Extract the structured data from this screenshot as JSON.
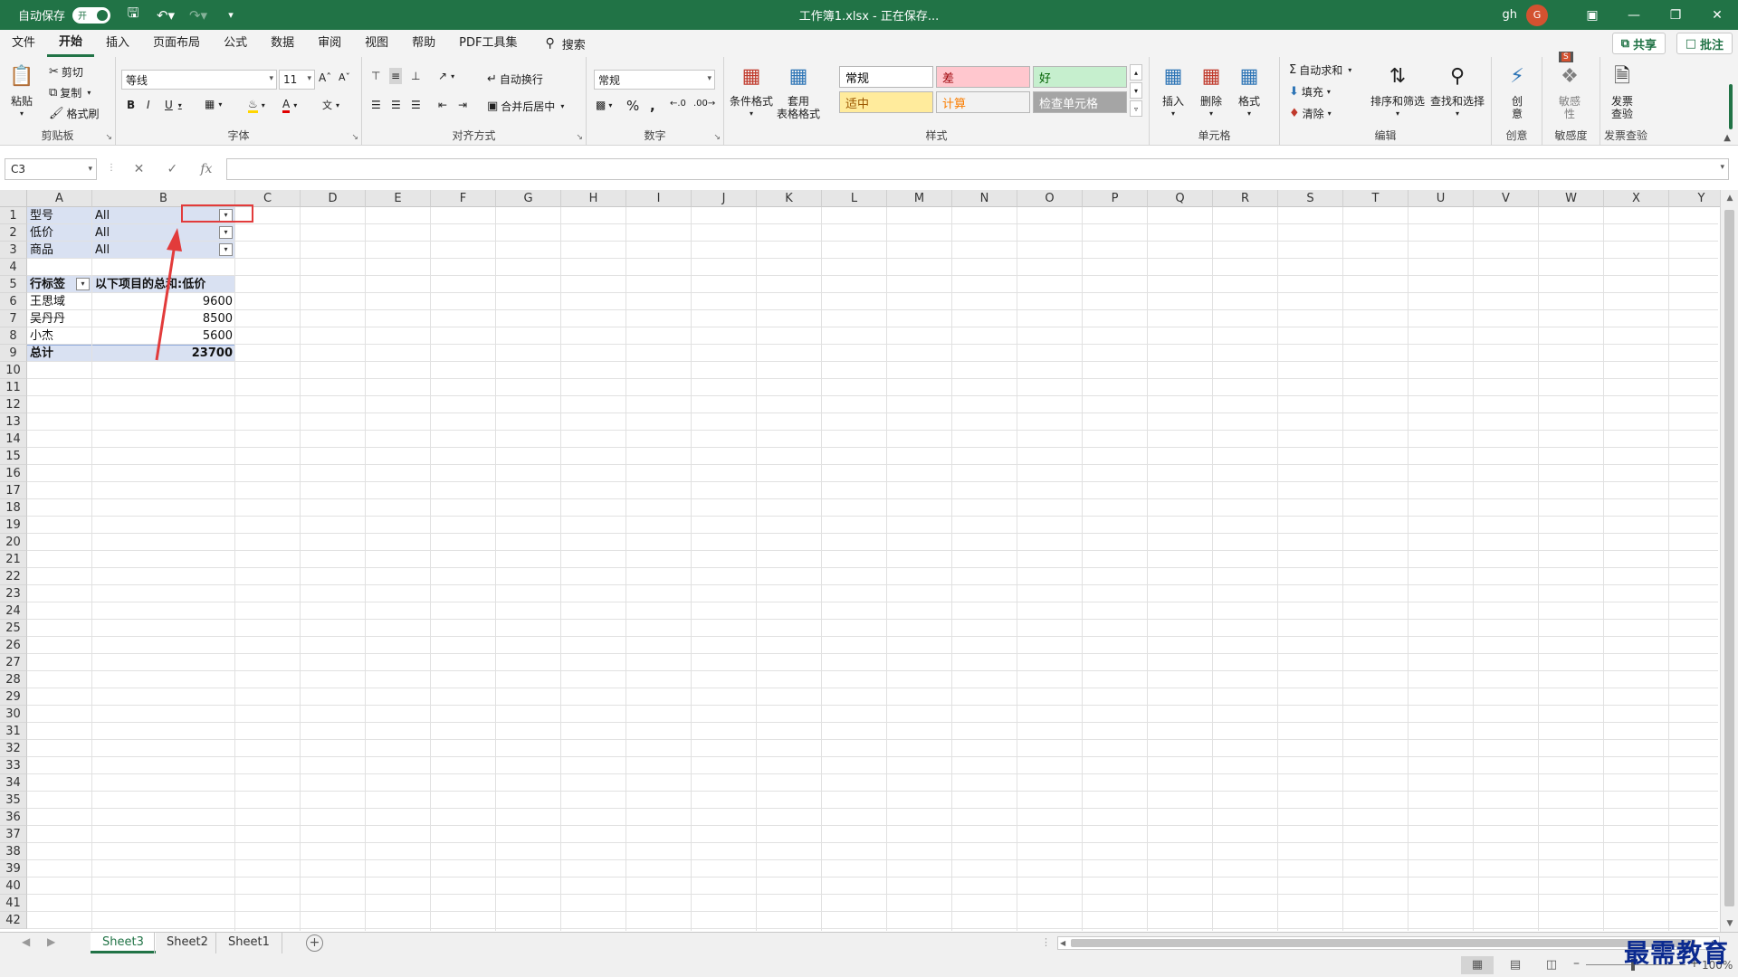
{
  "titlebar": {
    "autosave_label": "自动保存",
    "autosave_toggle": "开",
    "document_title": "工作簿1.xlsx  -  正在保存...",
    "user_name": "gh",
    "avatar_initial": "G",
    "accent_color": "#217346"
  },
  "menu": {
    "tabs": [
      "文件",
      "开始",
      "插入",
      "页面布局",
      "公式",
      "数据",
      "审阅",
      "视图",
      "帮助",
      "PDF工具集"
    ],
    "active_tab": "开始",
    "search_label": "搜索",
    "share_label": "共享",
    "comment_label": "批注"
  },
  "ribbon": {
    "clipboard": {
      "label": "剪贴板",
      "paste": "粘贴",
      "cut": "剪切",
      "copy": "复制",
      "format_painter": "格式刷"
    },
    "font": {
      "label": "字体",
      "font_name": "等线",
      "font_size": "11",
      "bold": "B",
      "italic": "I",
      "underline": "U"
    },
    "alignment": {
      "label": "对齐方式",
      "wrap_text": "自动换行",
      "merge_center": "合并后居中"
    },
    "number": {
      "label": "数字",
      "format": "常规",
      "percent": "%"
    },
    "styles": {
      "label": "样式",
      "conditional_format": "条件格式",
      "table_format_1": "套用",
      "table_format_2": "表格格式",
      "cells": [
        {
          "name": "常规",
          "bg": "#ffffff",
          "color": "#000000"
        },
        {
          "name": "差",
          "bg": "#ffc7ce",
          "color": "#9c0006"
        },
        {
          "name": "好",
          "bg": "#c6efce",
          "color": "#006100"
        },
        {
          "name": "适中",
          "bg": "#ffeb9c",
          "color": "#9c5700"
        },
        {
          "name": "计算",
          "bg": "#f2f2f2",
          "color": "#fa7d00"
        },
        {
          "name": "检查单元格",
          "bg": "#a5a5a5",
          "color": "#ffffff"
        }
      ]
    },
    "cells_group": {
      "label": "单元格",
      "insert": "插入",
      "delete": "删除",
      "format": "格式"
    },
    "editing": {
      "label": "编辑",
      "autosum": "自动求和",
      "fill": "填充",
      "clear": "清除",
      "sort_filter": "排序和筛选",
      "find_select": "查找和选择"
    },
    "ideas": {
      "label": "创意",
      "button_1": "创",
      "button_2": "意"
    },
    "sensitivity": {
      "label": "敏感度",
      "button_1": "敏感",
      "button_2": "性"
    },
    "invoice": {
      "label": "发票查验",
      "button_1": "发票",
      "button_2": "查验"
    }
  },
  "formula_bar": {
    "name_box": "C3",
    "fx": "fx",
    "formula": ""
  },
  "grid": {
    "columns": [
      "A",
      "B",
      "C",
      "D",
      "E",
      "F",
      "G",
      "H",
      "I",
      "J",
      "K",
      "L",
      "M",
      "N",
      "O",
      "P",
      "Q",
      "R",
      "S",
      "T",
      "U",
      "V",
      "W",
      "X",
      "Y"
    ],
    "rows": [
      "1",
      "2",
      "3",
      "4",
      "5",
      "6",
      "7",
      "8",
      "9",
      "10",
      "11",
      "12",
      "13",
      "14",
      "15",
      "16",
      "17",
      "18",
      "19",
      "20",
      "21",
      "22",
      "23",
      "24",
      "25",
      "26",
      "27",
      "28",
      "29",
      "30",
      "31",
      "32",
      "33",
      "34",
      "35",
      "36",
      "37",
      "38",
      "39",
      "40",
      "41",
      "42"
    ],
    "filters": [
      {
        "field": "型号",
        "value": "All"
      },
      {
        "field": "低价",
        "value": "All"
      },
      {
        "field": "商品",
        "value": "All"
      }
    ],
    "pivot_header": {
      "row_label": "行标签",
      "value_label": "以下项目的总和:低价"
    },
    "pivot_rows": [
      {
        "name": "王思域",
        "value": "9600"
      },
      {
        "name": "吴丹丹",
        "value": "8500"
      },
      {
        "name": "小杰",
        "value": "5600"
      }
    ],
    "pivot_total": {
      "name": "总计",
      "value": "23700"
    },
    "pivot_color": "#d9e1f2"
  },
  "sheets": {
    "tabs": [
      "Sheet3",
      "Sheet2",
      "Sheet1"
    ],
    "active": "Sheet3"
  },
  "statusbar": {
    "zoom": "100%"
  },
  "watermark": "最需教育",
  "annotation_color": "#e23b3b"
}
